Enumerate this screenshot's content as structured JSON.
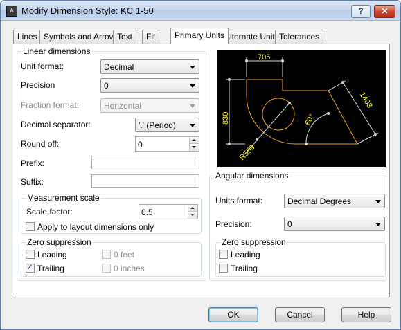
{
  "window": {
    "title": "Modify Dimension Style: KC 1-50",
    "icon_text": "A",
    "help_button": "?",
    "close_button": "✕"
  },
  "tabs": [
    {
      "label": "Lines",
      "active": false
    },
    {
      "label": "Symbols and Arrows",
      "active": false
    },
    {
      "label": "Text",
      "active": false
    },
    {
      "label": "Fit",
      "active": false
    },
    {
      "label": "Primary Units",
      "active": true
    },
    {
      "label": "Alternate Units",
      "active": false
    },
    {
      "label": "Tolerances",
      "active": false
    }
  ],
  "linear": {
    "title": "Linear dimensions",
    "unit_format": {
      "label": "Unit format:",
      "value": "Decimal"
    },
    "precision": {
      "label": "Precision",
      "value": "0"
    },
    "fraction_format": {
      "label": "Fraction format:",
      "value": "Horizontal"
    },
    "decimal_separator": {
      "label": "Decimal separator:",
      "value": "'.' (Period)"
    },
    "round_off": {
      "label": "Round off:",
      "value": "0"
    },
    "prefix": {
      "label": "Prefix:",
      "value": ""
    },
    "suffix": {
      "label": "Suffix:",
      "value": ""
    }
  },
  "measurement": {
    "title": "Measurement scale",
    "scale_factor": {
      "label": "Scale factor:",
      "value": "0.5"
    },
    "layout_only": {
      "label": "Apply to layout dimensions only",
      "checked": false
    }
  },
  "zero_linear": {
    "title": "Zero suppression",
    "leading": {
      "label": "Leading",
      "checked": false
    },
    "trailing": {
      "label": "Trailing",
      "checked": true
    },
    "feet": {
      "label": "0 feet",
      "checked": false
    },
    "inches": {
      "label": "0 inches",
      "checked": false
    }
  },
  "preview": {
    "dim_top": "705",
    "dim_left": "830",
    "dim_right": "1403",
    "dim_angle": "60°",
    "dim_radius": "R559",
    "colors": {
      "background": "#000000",
      "geometry": "#e8a317",
      "dimension": "#d8d8d8",
      "text": "#ffff00"
    }
  },
  "angular": {
    "title": "Angular dimensions",
    "units_format": {
      "label": "Units format:",
      "value": "Decimal Degrees"
    },
    "precision": {
      "label": "Precision:",
      "value": "0"
    }
  },
  "zero_angular": {
    "title": "Zero suppression",
    "leading": {
      "label": "Leading",
      "checked": false
    },
    "trailing": {
      "label": "Trailing",
      "checked": false
    }
  },
  "buttons": {
    "ok": "OK",
    "cancel": "Cancel",
    "help": "Help"
  }
}
